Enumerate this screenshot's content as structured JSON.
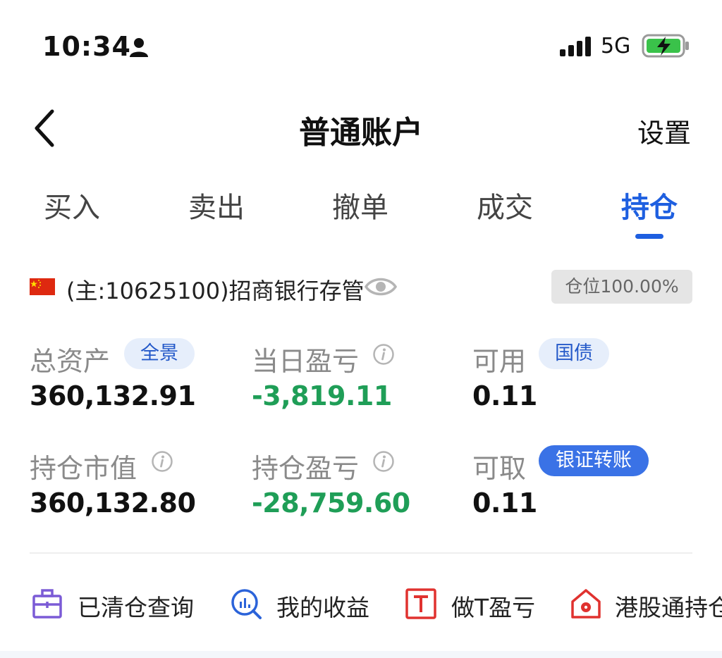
{
  "status_bar": {
    "time": "10:34",
    "network": "5G",
    "icons": [
      "person-icon",
      "signal-icon",
      "battery-charging-icon"
    ]
  },
  "nav": {
    "title": "普通账户",
    "settings_label": "设置",
    "back_icon": "chevron-left-icon"
  },
  "tabs": [
    {
      "label": "买入",
      "active": false
    },
    {
      "label": "卖出",
      "active": false
    },
    {
      "label": "撤单",
      "active": false
    },
    {
      "label": "成交",
      "active": false
    },
    {
      "label": "持仓",
      "active": true
    }
  ],
  "account": {
    "text": "(主:10625100)招商银行存管",
    "position_ratio": "仓位100.00%",
    "flag_icon": "china-flag-icon",
    "visibility_icon": "eye-icon"
  },
  "metrics": {
    "total_assets": {
      "label": "总资产",
      "tag": "全景",
      "value": "360,132.91"
    },
    "daily_pnl": {
      "label": "当日盈亏",
      "value": "-3,819.11"
    },
    "available": {
      "label": "可用",
      "tag": "国债",
      "value": "0.11"
    },
    "market_value": {
      "label": "持仓市值",
      "value": "360,132.80"
    },
    "position_pnl": {
      "label": "持仓盈亏",
      "value": "-28,759.60"
    },
    "withdrawable": {
      "label": "可取",
      "tag": "银证转账",
      "value": "0.11"
    }
  },
  "tools": [
    {
      "label": "已清仓查询",
      "icon": "briefcase-icon"
    },
    {
      "label": "我的收益",
      "icon": "chart-search-icon"
    },
    {
      "label": "做T盈亏",
      "icon": "t-box-icon"
    },
    {
      "label": "港股通持仓",
      "icon": "hk-house-icon"
    }
  ],
  "colors": {
    "accent": "#1e5fe0",
    "loss_green": "#1f9e57",
    "label_gray": "#8a8a8a",
    "pill_light_bg": "#e6eefb",
    "pill_solid_bg": "#3a72e6"
  }
}
